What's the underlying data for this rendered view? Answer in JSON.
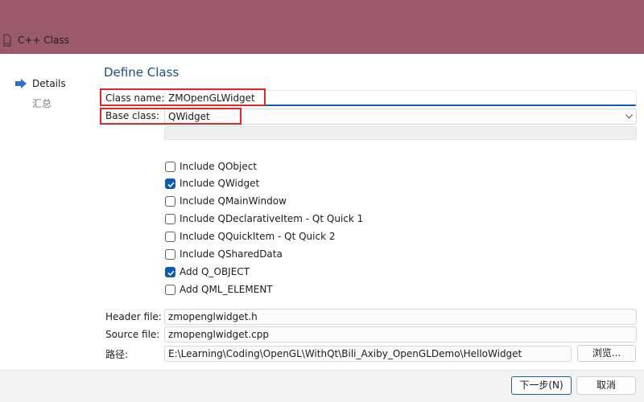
{
  "window": {
    "title": "C++ Class",
    "titlebar_color": "#9a5a68",
    "icon": "document-icon"
  },
  "sidebar": {
    "items": [
      {
        "label": "Details",
        "active": true,
        "icon": "arrow-right-icon"
      },
      {
        "label": "汇总",
        "active": false
      }
    ]
  },
  "form": {
    "section_title": "Define Class",
    "class_name": {
      "label": "Class name:",
      "value": "ZMOpenGLWidget"
    },
    "base_class": {
      "label": "Base class:",
      "value": "QWidget"
    },
    "options": [
      {
        "label": "Include QObject",
        "checked": false
      },
      {
        "label": "Include QWidget",
        "checked": true
      },
      {
        "label": "Include QMainWindow",
        "checked": false
      },
      {
        "label": "Include QDeclarativeItem - Qt Quick 1",
        "checked": false
      },
      {
        "label": "Include QQuickItem - Qt Quick 2",
        "checked": false
      },
      {
        "label": "Include QSharedData",
        "checked": false
      },
      {
        "label": "Add Q_OBJECT",
        "checked": true
      },
      {
        "label": "Add QML_ELEMENT",
        "checked": false
      }
    ],
    "header_file": {
      "label": "Header file:",
      "value": "zmopenglwidget.h"
    },
    "source_file": {
      "label": "Source file:",
      "value": "zmopenglwidget.cpp"
    },
    "path": {
      "label": "路径:",
      "value": "E:\\Learning\\Coding\\OpenGL\\WithQt\\Bili_Axiby_OpenGLDemo\\HelloWidget"
    },
    "browse_label": "浏览..."
  },
  "footer": {
    "next_label": "下一步(N)",
    "cancel_label": "取消"
  },
  "colors": {
    "accent": "#0b5cb5",
    "highlight_red": "#e02828",
    "section_title": "#1a4d8f"
  }
}
